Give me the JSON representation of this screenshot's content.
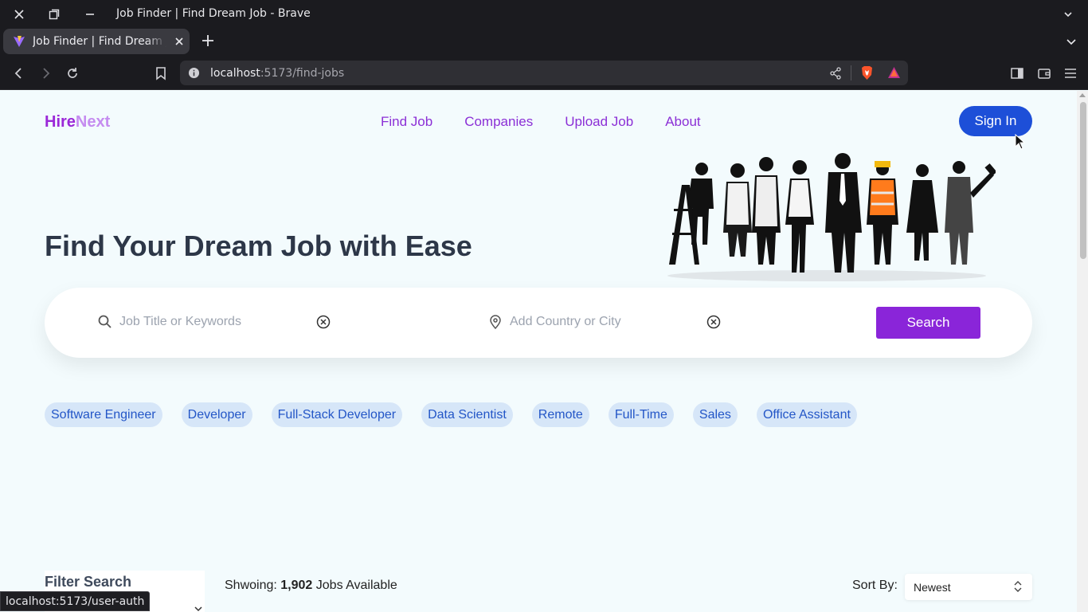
{
  "browser": {
    "window_title": "Job Finder | Find Dream Job - Brave",
    "tab_title": "Job Finder | Find Dream Job",
    "url_host": "localhost",
    "url_path": ":5173/find-jobs",
    "status_url": "localhost:5173/user-auth"
  },
  "header": {
    "logo_part1": "Hire",
    "logo_part2": "Next",
    "nav": [
      {
        "label": "Find Job"
      },
      {
        "label": "Companies"
      },
      {
        "label": "Upload Job"
      },
      {
        "label": "About"
      }
    ],
    "signin_label": "Sign In"
  },
  "hero": {
    "title": "Find Your Dream Job with Ease",
    "image_icon": "workers-silhouette-illustration"
  },
  "search": {
    "keyword_placeholder": "Job Title or Keywords",
    "location_placeholder": "Add Country or City",
    "button_label": "Search"
  },
  "popular_tags": [
    "Software Engineer",
    "Developer",
    "Full-Stack Developer",
    "Data Scientist",
    "Remote",
    "Full-Time",
    "Sales",
    "Office Assistant"
  ],
  "results": {
    "filter_title": "Filter Search",
    "showing_prefix": "Shwoing:",
    "count": "1,902",
    "showing_suffix": "Jobs Available",
    "sort_label": "Sort By:",
    "sort_value": "Newest"
  },
  "colors": {
    "accent_purple": "#8a25d9",
    "signin_blue": "#1d4fd8",
    "chip_bg": "#d6e6f8",
    "chip_text": "#2356c7",
    "page_bg": "#f3fbfd"
  }
}
